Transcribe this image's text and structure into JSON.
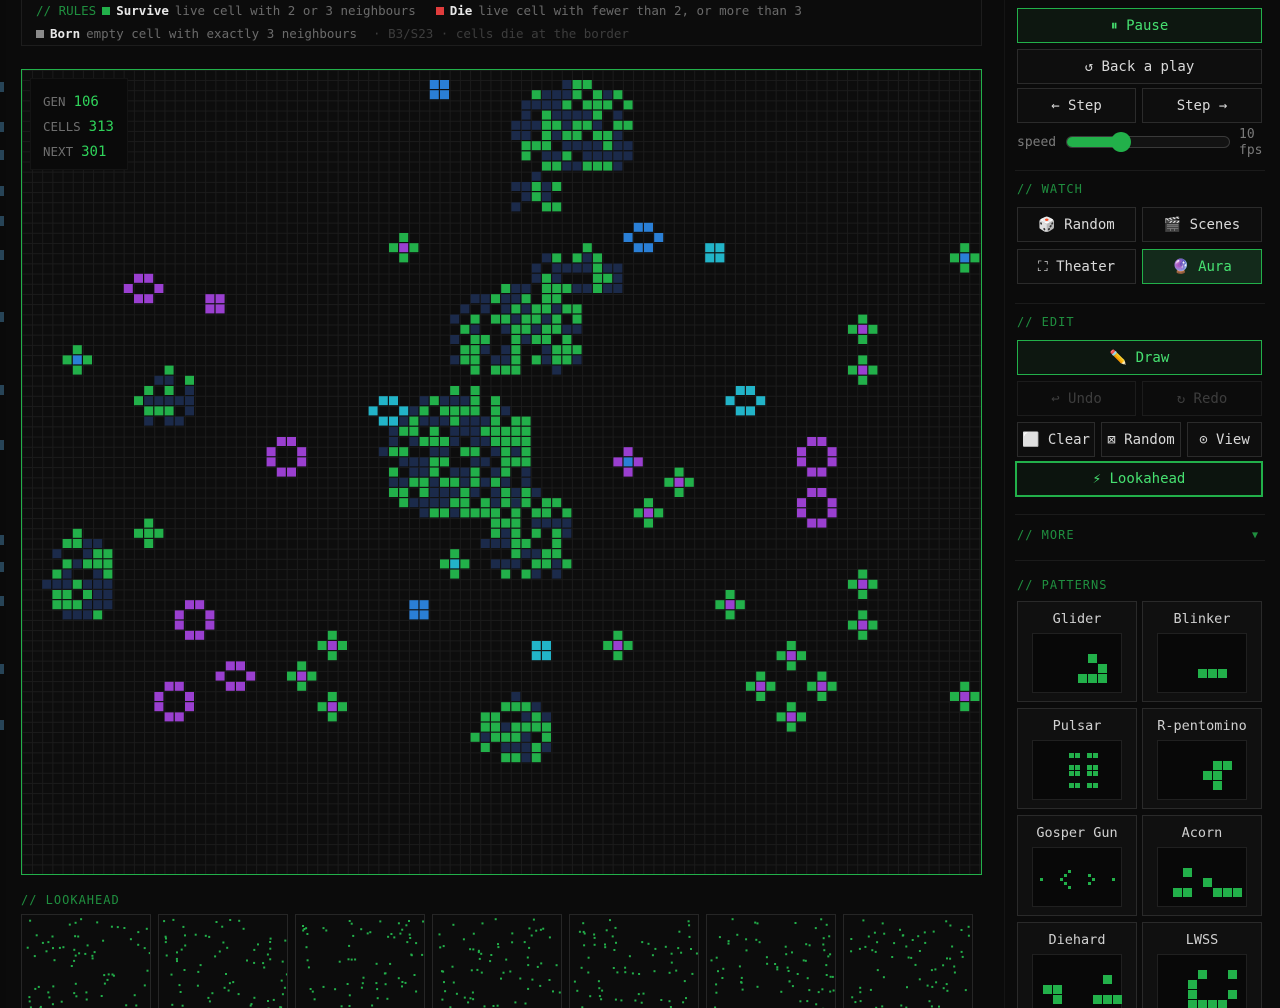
{
  "rules": {
    "heading": "// RULES",
    "survive_label": "Survive",
    "survive_text": "live cell with 2 or 3 neighbours",
    "die_label": "Die",
    "die_text": "live cell with fewer than 2, or more than 3",
    "born_label": "Born",
    "born_text": "empty cell with exactly 3 neighbours",
    "rule_note": "· B3/S23 · cells die at the border"
  },
  "stats": {
    "gen_label": "GEN",
    "gen_value": "106",
    "cells_label": "CELLS",
    "cells_value": "313",
    "next_label": "NEXT",
    "next_value": "301"
  },
  "lookahead": {
    "heading": "// LOOKAHEAD"
  },
  "controls": {
    "pause": "⏸ Pause",
    "back": "↺ Back a play",
    "step_back": "← Step",
    "step_fwd": "Step →",
    "speed_label": "speed",
    "speed_value": "10",
    "speed_unit": "fps",
    "speed_fraction": 0.33
  },
  "watch": {
    "heading": "// WATCH",
    "random": "🎲 Random",
    "scenes": "🎬 Scenes",
    "theater": "⛶ Theater",
    "aura": "🔮 Aura"
  },
  "edit": {
    "heading": "// EDIT",
    "draw": "✏️ Draw",
    "undo": "↩ Undo",
    "redo": "↻ Redo",
    "clear": "⬜ Clear",
    "random": "⊠ Random",
    "view": "⊙ View",
    "lookahead": "⚡ Lookahead"
  },
  "more": {
    "heading": "// MORE",
    "arrow": "▼"
  },
  "patterns": {
    "heading": "// PATTERNS",
    "items": [
      "Glider",
      "Blinker",
      "Pulsar",
      "R-pentomino",
      "Gosper Gun",
      "Acorn",
      "Diehard",
      "LWSS"
    ]
  },
  "colors": {
    "accent": "#22b04a",
    "live": "#22b04a",
    "fading": "#1b2a4a",
    "purple": "#9a3fd0",
    "blue": "#2a7fd6",
    "cyan": "#22b4c8",
    "die": "#e03c3c"
  }
}
